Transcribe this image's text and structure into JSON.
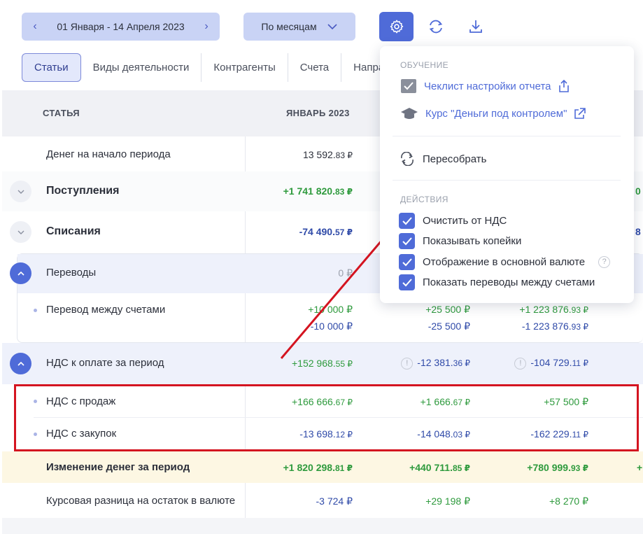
{
  "toolbar": {
    "date_range": "01 Января - 14 Апреля 2023",
    "period": "По месяцам"
  },
  "tabs": [
    {
      "label": "Статьи",
      "active": true
    },
    {
      "label": "Виды деятельности"
    },
    {
      "label": "Контрагенты"
    },
    {
      "label": "Счета"
    },
    {
      "label": "Напра"
    }
  ],
  "table": {
    "col_article": "СТАТЬЯ",
    "col_month1": "ЯНВАРЬ 2023",
    "rows": {
      "start_balance": {
        "label": "Денег на начало периода",
        "v1": "13 592.",
        "v1c": "83 ₽"
      },
      "income": {
        "label": "Поступления",
        "v1": "+1 741 820.",
        "v1c": "83 ₽",
        "edge": "0"
      },
      "expense": {
        "label": "Списания",
        "v1": "-74 490.",
        "v1c": "57 ₽",
        "edge": "8"
      },
      "transfers": {
        "label": "Переводы",
        "v1": "0 ₽"
      },
      "transfer_between": {
        "label": "Перевод между счетами",
        "v1a": "+10 000 ₽",
        "v1b": "-10 000 ₽",
        "v2a": "+25 500 ₽",
        "v2b": "-25 500 ₽",
        "v3a": "+1 223 876.",
        "v3ac": "93 ₽",
        "v3b": "-1 223 876.",
        "v3bc": "93 ₽"
      },
      "vat_due": {
        "label": "НДС к оплате за период",
        "v1": "+152 968.",
        "v1c": "55 ₽",
        "v2": "-12 381.",
        "v2c": "36 ₽",
        "v3": "-104 729.",
        "v3c": "11 ₽"
      },
      "vat_sales": {
        "label": "НДС с продаж",
        "v1": "+166 666.",
        "v1c": "67 ₽",
        "v2": "+1 666.",
        "v2c": "67 ₽",
        "v3": "+57 500 ₽"
      },
      "vat_purchases": {
        "label": "НДС с закупок",
        "v1": "-13 698.",
        "v1c": "12 ₽",
        "v2": "-14 048.",
        "v2c": "03 ₽",
        "v3": "-162 229.",
        "v3c": "11 ₽"
      },
      "change": {
        "label": "Изменение денег за период",
        "v1": "+1 820 298.",
        "v1c": "81 ₽",
        "v2": "+440 711.",
        "v2c": "85 ₽",
        "v3": "+780 999.",
        "v3c": "93 ₽",
        "edge": "+"
      },
      "fx_diff": {
        "label": "Курсовая разница на остаток в валюте",
        "v1": "-3 724 ₽",
        "v2": "+29 198 ₽",
        "v3": "+8 270 ₽"
      }
    }
  },
  "dropdown": {
    "section_learning": "ОБУЧЕНИЕ",
    "checklist": "Чеклист настройки отчета",
    "course": "Курс \"Деньги под контролем\"",
    "rebuild": "Пересобрать",
    "section_actions": "ДЕЙСТВИЯ",
    "options": [
      {
        "label": "Очистить от НДС",
        "checked": true
      },
      {
        "label": "Показывать копейки",
        "checked": true
      },
      {
        "label": "Отображение в основной валюте",
        "checked": true
      },
      {
        "label": "Показать переводы между счетами",
        "checked": true
      }
    ],
    "help_glyph": "?"
  },
  "info_glyph": "!",
  "colors": {
    "accent": "#4f6bd8",
    "positive": "#2e9a3d",
    "negative": "#2f4aa8",
    "annotation": "#d41420"
  }
}
